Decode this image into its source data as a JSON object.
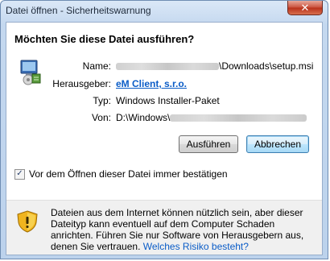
{
  "window": {
    "title": "Datei öffnen - Sicherheitswarnung",
    "close_glyph": "✕"
  },
  "dialog": {
    "heading": "Möchten Sie diese Datei ausführen?",
    "fields": {
      "name_label": "Name:",
      "name_value": "\\Downloads\\setup.msi",
      "publisher_label": "Herausgeber:",
      "publisher_value": "eM Client, s.r.o.",
      "type_label": "Typ:",
      "type_value": "Windows Installer-Paket",
      "from_label": "Von:",
      "from_value": "D:\\Windows\\"
    },
    "buttons": {
      "run": "Ausführen",
      "cancel": "Abbrechen"
    },
    "checkbox": {
      "label": "Vor dem Öffnen dieser Datei immer bestätigen",
      "checked": true,
      "check_glyph": "✓"
    },
    "warning": {
      "text": "Dateien aus dem Internet können nützlich sein, aber dieser Dateityp kann eventuell auf dem Computer Schaden anrichten. Führen Sie nur Software von Herausgebern aus, denen Sie vertrauen.",
      "link": "Welches Risiko besteht?"
    }
  },
  "icons": {
    "app": "installer-package-icon",
    "warning": "security-shield-icon"
  },
  "colors": {
    "link": "#0a5cc7",
    "titlebar": "#c4d8ef",
    "close": "#c9503b"
  }
}
